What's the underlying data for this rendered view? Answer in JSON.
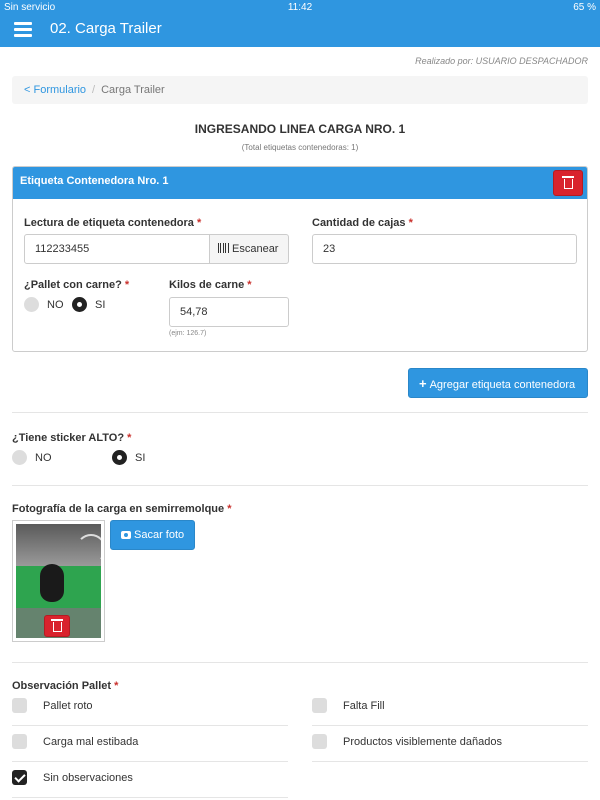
{
  "statusbar": {
    "carrier": "Sin servicio",
    "time": "11:42",
    "battery": "65 %"
  },
  "navbar": {
    "title": "02. Carga Trailer"
  },
  "realizado_por": "Realizado por: USUARIO DESPACHADOR",
  "breadcrumb": {
    "back": "< Formulario",
    "current": "Carga Trailer"
  },
  "heading": {
    "title": "INGRESANDO LINEA CARGA NRO. 1",
    "subtitle": "(Total etiquetas contenedoras: 1)"
  },
  "panel": {
    "title": "Etiqueta Contenedora Nro. 1",
    "lectura_label": "Lectura de etiqueta contenedora",
    "lectura_value": "112233455",
    "scan_button": "Escanear",
    "cajas_label": "Cantidad de cajas",
    "cajas_value": "23",
    "pallet_label": "¿Pallet con carne?",
    "pallet_no": "NO",
    "pallet_si": "SI",
    "pallet_selected": "SI",
    "kilos_label": "Kilos de carne",
    "kilos_value": "54,78",
    "kilos_hint": "(ejm: 126.7)"
  },
  "add_button": "Agregar etiqueta contenedora",
  "sticker": {
    "label": "¿Tiene sticker ALTO?",
    "no": "NO",
    "si": "SI",
    "selected": "SI"
  },
  "foto": {
    "label": "Fotografía de la carga en semirremolque",
    "button": "Sacar foto"
  },
  "observacion": {
    "label": "Observación Pallet",
    "options": [
      {
        "label": "Pallet roto",
        "checked": false
      },
      {
        "label": "Falta Fill",
        "checked": false
      },
      {
        "label": "Carga mal estibada",
        "checked": false
      },
      {
        "label": "Productos visiblemente dañados",
        "checked": false
      },
      {
        "label": "Sin observaciones",
        "checked": true
      }
    ]
  },
  "required_mark": "*",
  "colors": {
    "primary": "#2f96e0",
    "danger": "#d9232d"
  }
}
